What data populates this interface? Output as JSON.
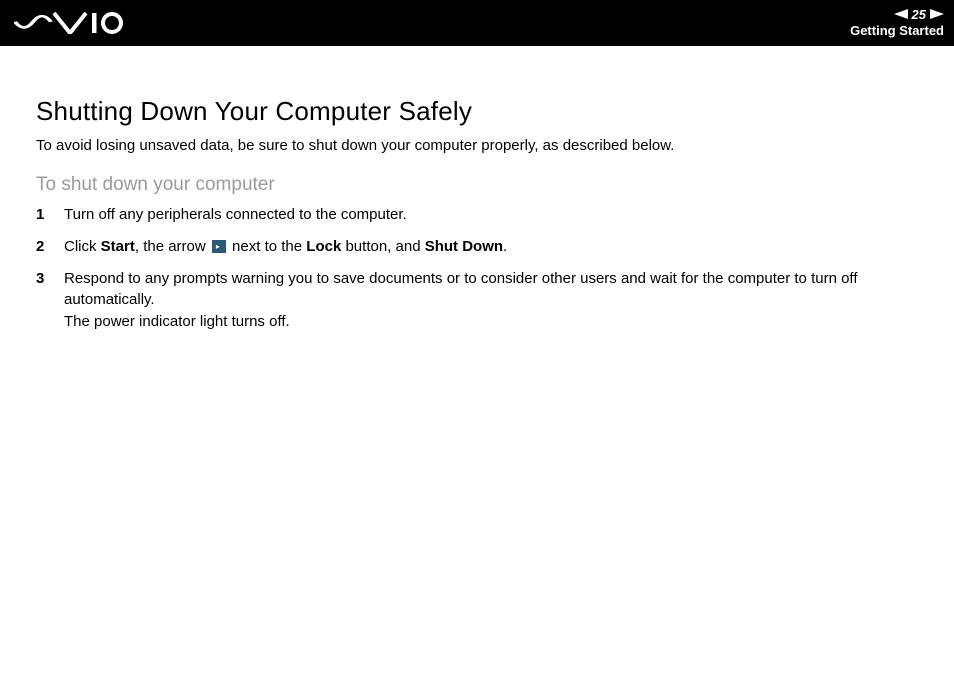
{
  "header": {
    "page_number": "25",
    "section": "Getting Started"
  },
  "content": {
    "title": "Shutting Down Your Computer Safely",
    "intro": "To avoid losing unsaved data, be sure to shut down your computer properly, as described below.",
    "subheading": "To shut down your computer",
    "steps": [
      {
        "text": "Turn off any peripherals connected to the computer."
      },
      {
        "prefix": "Click ",
        "b1": "Start",
        "mid1": ", the arrow ",
        "mid2": " next to the ",
        "b2": "Lock",
        "mid3": " button, and ",
        "b3": "Shut Down",
        "suffix": "."
      },
      {
        "line1": "Respond to any prompts warning you to save documents or to consider other users and wait for the computer to turn off automatically.",
        "line2": "The power indicator light turns off."
      }
    ]
  }
}
